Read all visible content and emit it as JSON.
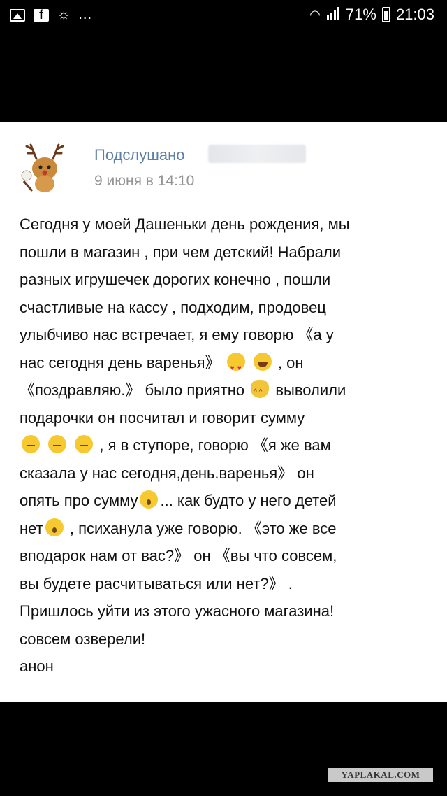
{
  "status_bar": {
    "left_icons": [
      "image-notification-icon",
      "facebook-notification-icon",
      "weather-notification-icon"
    ],
    "more": "...",
    "battery": "71%",
    "time": "21:03"
  },
  "post": {
    "author": "Подслушано",
    "date": "9 июня в 14:10",
    "lines": [
      [
        "Сегодня у моей Дашеньки день рождения, мы"
      ],
      [
        "пошли в магазин , при чем детский! Набрали"
      ],
      [
        "разных игрушечек дорогих конечно , пошли"
      ],
      [
        "счастливые на кассу , подходим, продовец"
      ],
      [
        "улыбчиво нас встречает, я ему говорю 《а у"
      ],
      [
        "нас сегодня день варенья》 ",
        "heart-eyes-emoji",
        " ",
        "smile-emoji",
        " , он"
      ],
      [
        "《поздравляю.》 было приятно ",
        "cat-emoji",
        " выволили"
      ],
      [
        "подарочки он посчитал и говорит сумму"
      ],
      [
        "neutral-emoji",
        " ",
        "neutral-emoji",
        " ",
        "neutral-emoji",
        " , я в ступоре, говорю 《я же вам"
      ],
      [
        "сказала у нас сегодня,день.варенья》 он"
      ],
      [
        "опять про сумму",
        "astonished-emoji",
        "... как будто у него детей"
      ],
      [
        "нет",
        "astonished-emoji",
        " , психанула уже говорю. 《это же все"
      ],
      [
        "вподарок нам от вас?》 он 《вы что совсем,"
      ],
      [
        "вы будете расчитываться или нет?》 ."
      ],
      [
        "Пришлось уйти из этого ужасного магазина!"
      ],
      [
        "совсем озверели!"
      ],
      [
        "анон"
      ]
    ]
  },
  "watermark": "YAPLAKAL.COM"
}
